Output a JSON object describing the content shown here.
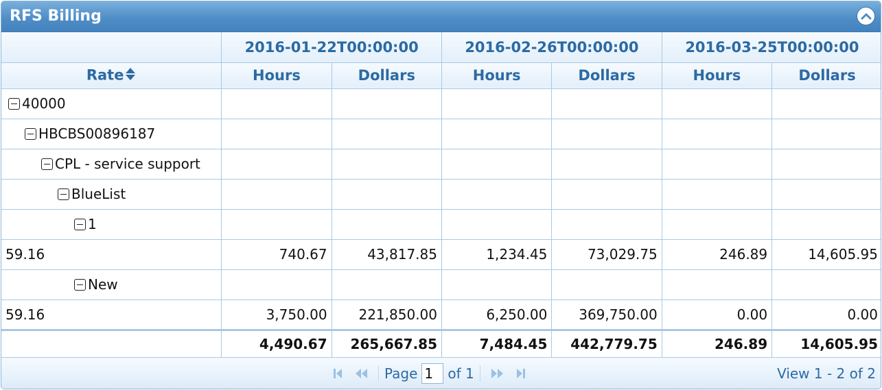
{
  "window": {
    "title": "RFS Billing"
  },
  "columns": {
    "row_header": "Rate",
    "periods": [
      "2016-01-22T00:00:00",
      "2016-02-26T00:00:00",
      "2016-03-25T00:00:00"
    ],
    "measures": [
      "Hours",
      "Dollars"
    ]
  },
  "rows": [
    {
      "label": "40000",
      "level": 0,
      "type": "group",
      "values": []
    },
    {
      "label": "HBCBS00896187",
      "level": 1,
      "type": "group",
      "values": []
    },
    {
      "label": "CPL - service support",
      "level": 2,
      "type": "group",
      "values": []
    },
    {
      "label": "BlueList",
      "level": 3,
      "type": "group",
      "values": []
    },
    {
      "label": "1",
      "level": 4,
      "type": "group",
      "values": []
    },
    {
      "label": "59.16",
      "level": 0,
      "type": "data",
      "values": [
        "740.67",
        "43,817.85",
        "1,234.45",
        "73,029.75",
        "246.89",
        "14,605.95"
      ]
    },
    {
      "label": "New",
      "level": 4,
      "type": "group",
      "values": []
    },
    {
      "label": "59.16",
      "level": 0,
      "type": "data",
      "values": [
        "3,750.00",
        "221,850.00",
        "6,250.00",
        "369,750.00",
        "0.00",
        "0.00"
      ]
    }
  ],
  "totals": [
    "4,490.67",
    "265,667.85",
    "7,484.45",
    "442,779.75",
    "246.89",
    "14,605.95"
  ],
  "pager": {
    "page_label": "Page",
    "page_value": "1",
    "of_label": "of 1",
    "view_text": "View 1 - 2 of 2"
  },
  "colors": {
    "header_text": "#2c6aa3",
    "titlebar": "#4d8cc6",
    "grid_line": "#a9c8e4"
  },
  "icons": [
    "chevron-up-icon",
    "sort-icon",
    "tree-collapse-icon",
    "first-page-icon",
    "prev-page-icon",
    "next-page-icon",
    "last-page-icon"
  ]
}
